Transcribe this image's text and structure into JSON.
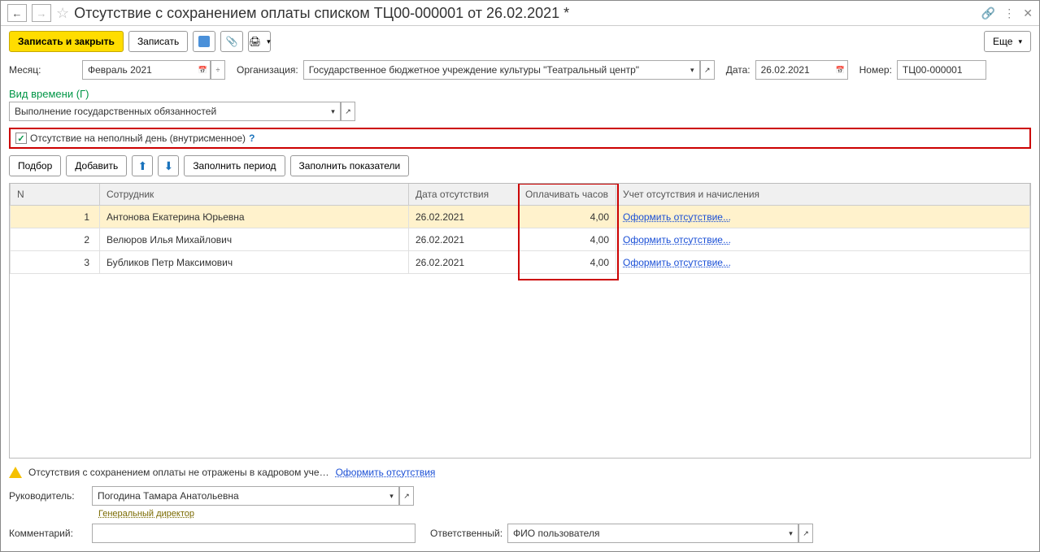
{
  "title": "Отсутствие с сохранением оплаты списком ТЦ00-000001 от 26.02.2021 *",
  "toolbar": {
    "save_close": "Записать и закрыть",
    "save": "Записать",
    "more": "Еще"
  },
  "fields": {
    "month_label": "Месяц:",
    "month_value": "Февраль 2021",
    "org_label": "Организация:",
    "org_value": "Государственное бюджетное учреждение культуры \"Театральный центр\"",
    "date_label": "Дата:",
    "date_value": "26.02.2021",
    "number_label": "Номер:",
    "number_value": "ТЦ00-000001"
  },
  "section": {
    "header": "Вид времени (Г)",
    "type_value": "Выполнение государственных обязанностей",
    "partial_label": "Отсутствие на неполный день (внутрисменное)",
    "partial_checked": true
  },
  "table_toolbar": {
    "select": "Подбор",
    "add": "Добавить",
    "fill_period": "Заполнить период",
    "fill_indicators": "Заполнить показатели"
  },
  "columns": {
    "n": "N",
    "employee": "Сотрудник",
    "date": "Дата отсутствия",
    "hours": "Оплачивать часов",
    "accounting": "Учет отсутствия и начисления"
  },
  "rows": [
    {
      "n": "1",
      "employee": "Антонова Екатерина Юрьевна",
      "date": "26.02.2021",
      "hours": "4,00",
      "link": "Оформить отсутствие..."
    },
    {
      "n": "2",
      "employee": "Велюров Илья Михайлович",
      "date": "26.02.2021",
      "hours": "4,00",
      "link": "Оформить отсутствие..."
    },
    {
      "n": "3",
      "employee": "Бубликов Петр Максимович",
      "date": "26.02.2021",
      "hours": "4,00",
      "link": "Оформить отсутствие..."
    }
  ],
  "warning": {
    "text": "Отсутствия с сохранением оплаты не отражены в кадровом уче…",
    "link": "Оформить отсутствия"
  },
  "footer": {
    "manager_label": "Руководитель:",
    "manager_value": "Погодина Тамара Анатольевна",
    "manager_position": "Генеральный директор",
    "comment_label": "Комментарий:",
    "comment_value": "",
    "responsible_label": "Ответственный:",
    "responsible_value": "ФИО пользователя"
  }
}
